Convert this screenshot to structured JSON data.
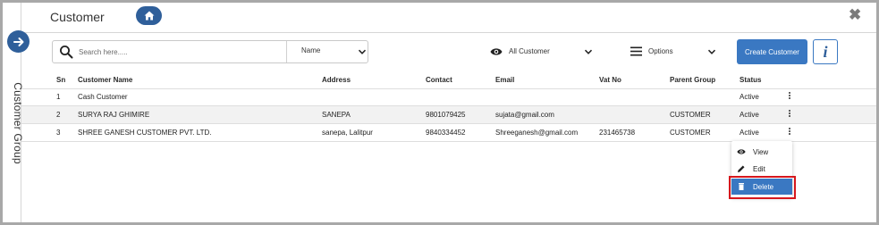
{
  "header": {
    "title": "Customer",
    "close_glyph": "✖"
  },
  "sidebar": {
    "expand_icon": "arrow-right-icon",
    "vertical_label": "Customer Group"
  },
  "toolbar": {
    "search_placeholder": "Search here.....",
    "search_field_selected": "Name",
    "filter_selected": "All Customer",
    "options_label": "Options",
    "create_label": "Create Customer",
    "info_label": "i"
  },
  "table": {
    "columns": [
      "Sn",
      "Customer Name",
      "Address",
      "Contact",
      "Email",
      "Vat No",
      "Parent Group",
      "Status"
    ],
    "rows": [
      {
        "sn": "1",
        "name": "Cash Customer",
        "address": "",
        "contact": "",
        "email": "",
        "vat": "",
        "parent": "",
        "status": "Active"
      },
      {
        "sn": "2",
        "name": "SURYA RAJ GHIMIRE",
        "address": "SANEPA",
        "contact": "9801079425",
        "email": "sujata@gmail.com",
        "vat": "",
        "parent": "CUSTOMER",
        "status": "Active"
      },
      {
        "sn": "3",
        "name": "SHREE GANESH CUSTOMER PVT. LTD.",
        "address": "sanepa, Lalitpur",
        "contact": "9840334452",
        "email": "Shreeganesh@gmail.com",
        "vat": "231465738",
        "parent": "CUSTOMER",
        "status": "Active"
      }
    ]
  },
  "context_menu": {
    "items": [
      "View",
      "Edit",
      "Delete"
    ]
  },
  "colors": {
    "primary": "#3a78c2",
    "dark_primary": "#2f5f9a",
    "highlight_outline": "#d6171d"
  }
}
